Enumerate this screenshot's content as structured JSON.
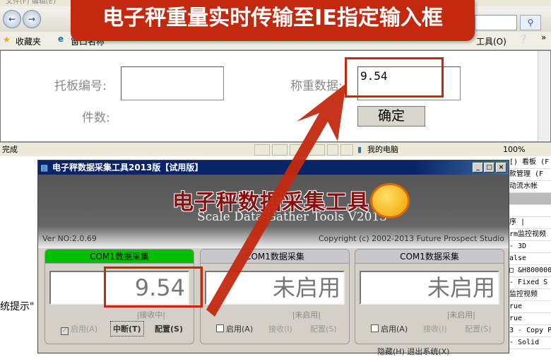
{
  "browser": {
    "menu": "文件(F)   编辑(E)",
    "back_icon": "back-arrow-icon",
    "forward_icon": "forward-arrow-icon",
    "favorites_label": "收藏夹",
    "tab_title": "窗口名称",
    "toolbar": {
      "tools_label": "工具(O)",
      "help_icon": "help-icon",
      "more": "»"
    },
    "status": {
      "text": "完成",
      "zone": "我的电脑",
      "zoom": "100%"
    }
  },
  "banner": {
    "text": "电子秤重量实时传输至IE指定输入框"
  },
  "form": {
    "pallet_label": "托板编号:",
    "pallet_value": "",
    "weight_label": "称重数据:",
    "weight_value": "9.54",
    "count_label": "件数:",
    "confirm_label": "确定"
  },
  "background": {
    "left_text": "统提示\"",
    "right_lines": [
      "[) 看板 (F",
      "款管理 (F",
      "动流水帐",
      "",
      "",
      "序 |",
      "rm监控视频",
      " - 3D",
      "alse",
      "□ &H800000",
      " - Fixed S",
      "监控视频",
      "rue",
      "rue",
      "3 - Copy P",
      " - Solid"
    ]
  },
  "app": {
    "title": "电子秤数据采集工具2013版【试用版】",
    "logo_cn": "电子秤数据采集工具",
    "logo_en": "Scale Data Gather Tools V2013",
    "version": "Ver NO:2.0.69",
    "copyright": "Copyright (c) 2002-2013 Future Prospect Studio",
    "header_active_color": "#00c000",
    "panels": [
      {
        "title": "COM1数据采集",
        "display": "9.54",
        "status": "|接收中|",
        "enable": "启用(A)",
        "enabled": true,
        "action": "中断(T)",
        "config": "配置(S)",
        "active": true
      },
      {
        "title": "COM1数据采集",
        "display": "未启用",
        "status": "|未启用|",
        "enable": "启用(A)",
        "enabled": false,
        "action": "接收(I)",
        "config": "配置(S)",
        "active": false
      },
      {
        "title": "COM1数据采集",
        "display": "未启用",
        "status": "|未启用|",
        "enable": "启用(A)",
        "enabled": false,
        "action": "接收(I)",
        "config": "配置(S)",
        "active": false
      }
    ],
    "bottom": "隐藏(H)    退出系统(X)"
  },
  "highlight_color": "#c2290f"
}
